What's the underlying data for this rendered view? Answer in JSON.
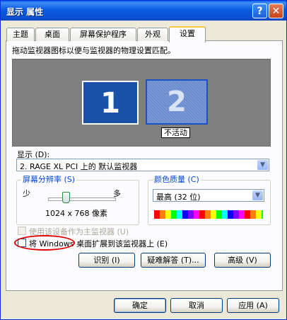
{
  "window": {
    "title": "显示 属性",
    "help": "?",
    "close": "✕"
  },
  "tabs": [
    {
      "label": "主题",
      "active": false
    },
    {
      "label": "桌面",
      "active": false
    },
    {
      "label": "屏幕保护程序",
      "active": false
    },
    {
      "label": "外观",
      "active": false
    },
    {
      "label": "设置",
      "active": true
    }
  ],
  "settings": {
    "instruction": "拖动监视器图标以便与监视器的物理设置匹配。",
    "monitors": [
      {
        "number": "1"
      },
      {
        "number": "2",
        "status": "不活动"
      }
    ],
    "display_label": "显示 (D):",
    "display_value": "2. RAGE XL  PCI 上的 默认监视器",
    "resolution": {
      "title": "屏幕分辨率 (S)",
      "less": "少",
      "more": "多",
      "value": "1024 x 768 像素"
    },
    "color_quality": {
      "title": "颜色质量 (C)",
      "value": "最高 (32 位)"
    },
    "primary_checkbox": {
      "label": "使用该设备作为主监视器 (U)",
      "checked": false,
      "disabled": true
    },
    "extend_checkbox": {
      "label": "将 Windows 桌面扩展到该监视器上 (E)",
      "checked": false
    },
    "buttons": {
      "identify": "识别 (I)",
      "troubleshoot": "疑难解答 (T)...",
      "advanced": "高级 (V)"
    }
  },
  "dialog_buttons": {
    "ok": "确定",
    "cancel": "取消",
    "apply": "应用 (A)"
  },
  "colors": {
    "titlebar": "#0a5ee8",
    "group_title": "#0046d5",
    "annotation_circle": "#e00000"
  }
}
